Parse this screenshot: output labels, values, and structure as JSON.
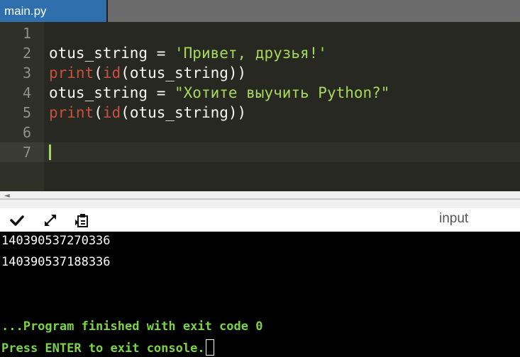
{
  "tabs": [
    {
      "label": "main.py",
      "active": true
    }
  ],
  "editor": {
    "lines": [
      {
        "number": "1",
        "parts": []
      },
      {
        "number": "2",
        "parts": [
          {
            "text": "otus_string = ",
            "cls": "plain"
          },
          {
            "text": "'Привет, друзья!'",
            "cls": "str"
          }
        ]
      },
      {
        "number": "3",
        "parts": [
          {
            "text": "print",
            "cls": "kw"
          },
          {
            "text": "(",
            "cls": "plain"
          },
          {
            "text": "id",
            "cls": "kw"
          },
          {
            "text": "(otus_string))",
            "cls": "plain"
          }
        ]
      },
      {
        "number": "4",
        "parts": [
          {
            "text": "otus_string = ",
            "cls": "plain"
          },
          {
            "text": "\"Хотите выучить Python?\"",
            "cls": "str"
          }
        ]
      },
      {
        "number": "5",
        "parts": [
          {
            "text": "print",
            "cls": "kw"
          },
          {
            "text": "(",
            "cls": "plain"
          },
          {
            "text": "id",
            "cls": "kw"
          },
          {
            "text": "(otus_string))",
            "cls": "plain"
          }
        ]
      },
      {
        "number": "6",
        "parts": []
      },
      {
        "number": "7",
        "parts": [],
        "active": true
      }
    ]
  },
  "console_toolbar": {
    "icons": [
      "collapse-check-icon",
      "expand-arrows-icon",
      "copy-clipboard-icon"
    ],
    "input_label": "input"
  },
  "console": {
    "output_lines": [
      "140390537270336",
      "140390537188336"
    ],
    "finished_message": "...Program finished with exit code 0",
    "press_enter_message": "Press ENTER to exit console."
  },
  "colors": {
    "tab_active": "#2f6fae",
    "editor_bg": "#272822",
    "keyword": "#c9513b",
    "string": "#a6d85c",
    "console_message": "#7cd444"
  }
}
